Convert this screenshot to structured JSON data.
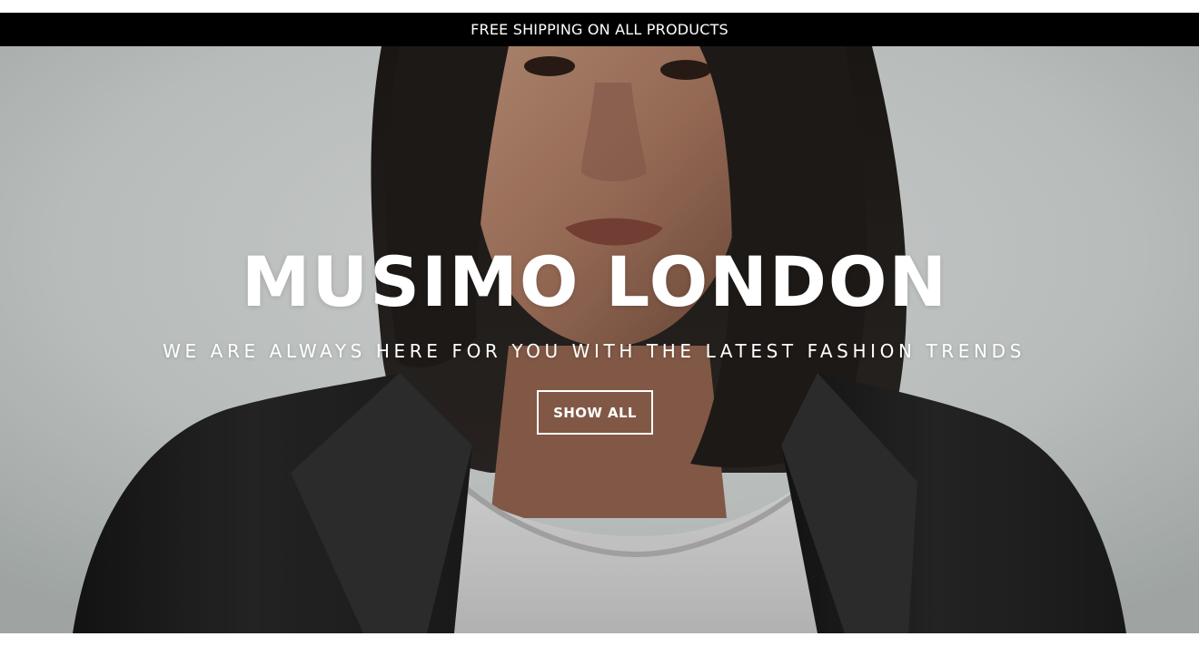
{
  "announcement": {
    "text": "FREE SHIPPING ON ALL PRODUCTS"
  },
  "hero": {
    "title": "MUSIMO LONDON",
    "subtitle": "WE ARE ALWAYS HERE FOR YOU WITH THE LATEST FASHION TRENDS",
    "button_label": "SHOW ALL",
    "image": "portrait-photo"
  },
  "colors": {
    "announcement_bg": "#000000",
    "announcement_text": "#ffffff",
    "hero_text": "#ffffff",
    "background": "#ffffff"
  }
}
